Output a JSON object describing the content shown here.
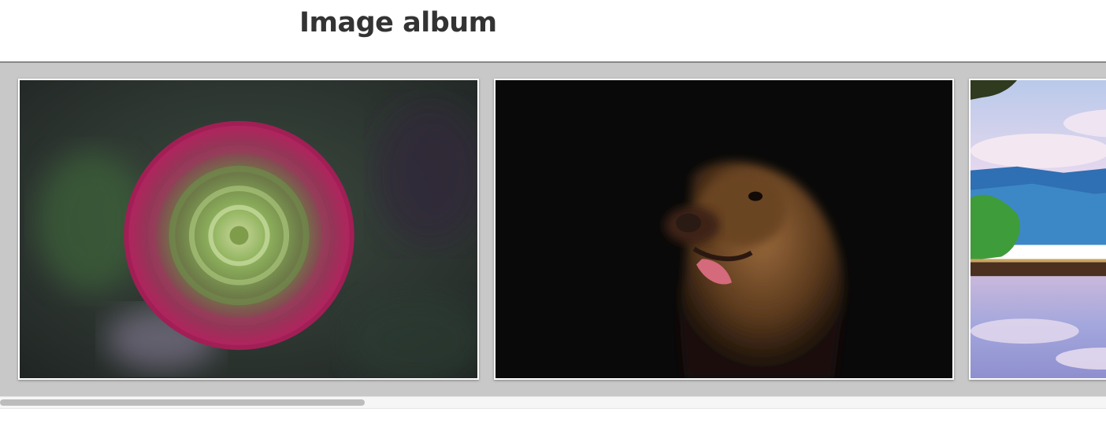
{
  "header": {
    "title": "Image album"
  },
  "album": {
    "images": [
      {
        "subject": "flower",
        "icon": "ranunculus-flower-photo"
      },
      {
        "subject": "dog",
        "icon": "golden-retriever-photo"
      },
      {
        "subject": "landscape",
        "icon": "lake-mountain-landscape-photo"
      }
    ]
  },
  "scrollbar": {
    "position_fraction": 0.0,
    "visible_fraction": 0.33
  },
  "colors": {
    "strip_background": "#c8c8c8",
    "title_text": "#333333"
  }
}
